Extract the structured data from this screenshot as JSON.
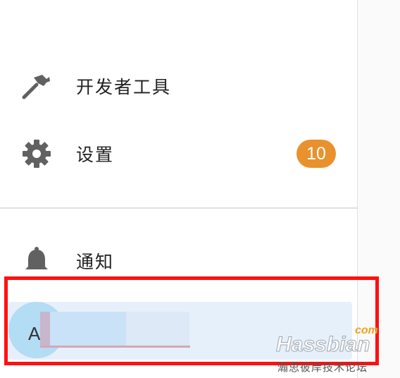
{
  "sidebar": {
    "items": [
      {
        "label": "开发者工具",
        "icon": "hammer-icon"
      },
      {
        "label": "设置",
        "icon": "gear-icon",
        "badge": "10"
      },
      {
        "label": "通知",
        "icon": "bell-icon"
      }
    ],
    "user": {
      "avatar_initial": "A"
    }
  },
  "watermark": {
    "brand": "Hassbian",
    "suffix": "com",
    "tagline": "瀚思彼岸技术论坛"
  },
  "colors": {
    "badge": "#e8912d",
    "icon": "#616161",
    "highlight": "#ff1010",
    "user_row_bg": "#e6f0fb"
  }
}
